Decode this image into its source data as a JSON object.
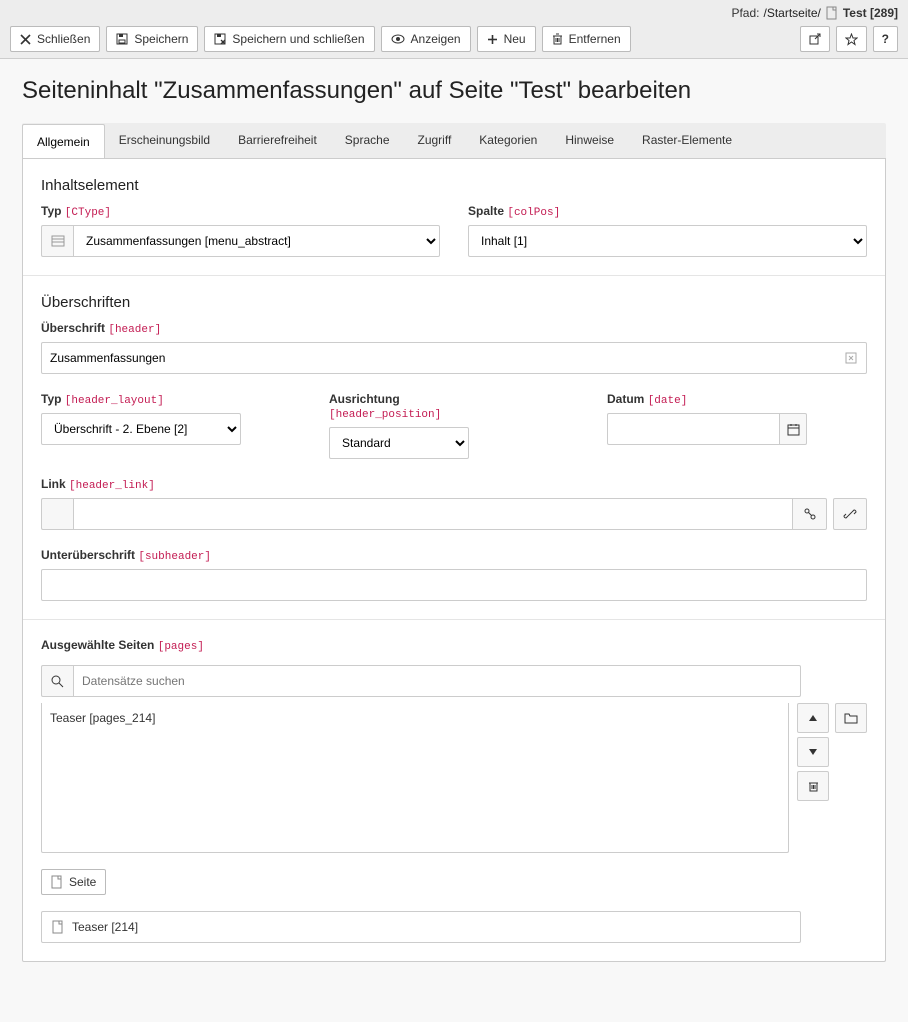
{
  "path": {
    "label": "Pfad:",
    "segments": [
      "/Startseite/"
    ],
    "current": "Test [289]"
  },
  "toolbar": {
    "close": "Schließen",
    "save": "Speichern",
    "save_close": "Speichern und schließen",
    "view": "Anzeigen",
    "new": "Neu",
    "remove": "Entfernen"
  },
  "heading": "Seiteninhalt \"Zusammenfassungen\" auf Seite \"Test\" bearbeiten",
  "tabs": [
    "Allgemein",
    "Erscheinungsbild",
    "Barrierefreiheit",
    "Sprache",
    "Zugriff",
    "Kategorien",
    "Hinweise",
    "Raster-Elemente"
  ],
  "sections": {
    "content_element": "Inhaltselement",
    "headlines": "Überschriften"
  },
  "fields": {
    "type": {
      "label": "Typ",
      "tech": "[CType]",
      "value": "Zusammenfassungen [menu_abstract]"
    },
    "column": {
      "label": "Spalte",
      "tech": "[colPos]",
      "value": "Inhalt [1]"
    },
    "header": {
      "label": "Überschrift",
      "tech": "[header]",
      "value": "Zusammenfassungen"
    },
    "header_layout": {
      "label": "Typ",
      "tech": "[header_layout]",
      "value": "Überschrift - 2. Ebene [2]"
    },
    "header_position": {
      "label": "Ausrichtung",
      "tech": "[header_position]",
      "value": "Standard"
    },
    "date": {
      "label": "Datum",
      "tech": "[date]",
      "value": ""
    },
    "link": {
      "label": "Link",
      "tech": "[header_link]",
      "value": ""
    },
    "subheader": {
      "label": "Unterüberschrift",
      "tech": "[subheader]",
      "value": ""
    },
    "pages": {
      "label": "Ausgewählte Seiten",
      "tech": "[pages]",
      "search_placeholder": "Datensätze suchen",
      "records": [
        "Teaser [pages_214]"
      ],
      "add_button": "Seite",
      "ref": "Teaser [214]"
    }
  }
}
